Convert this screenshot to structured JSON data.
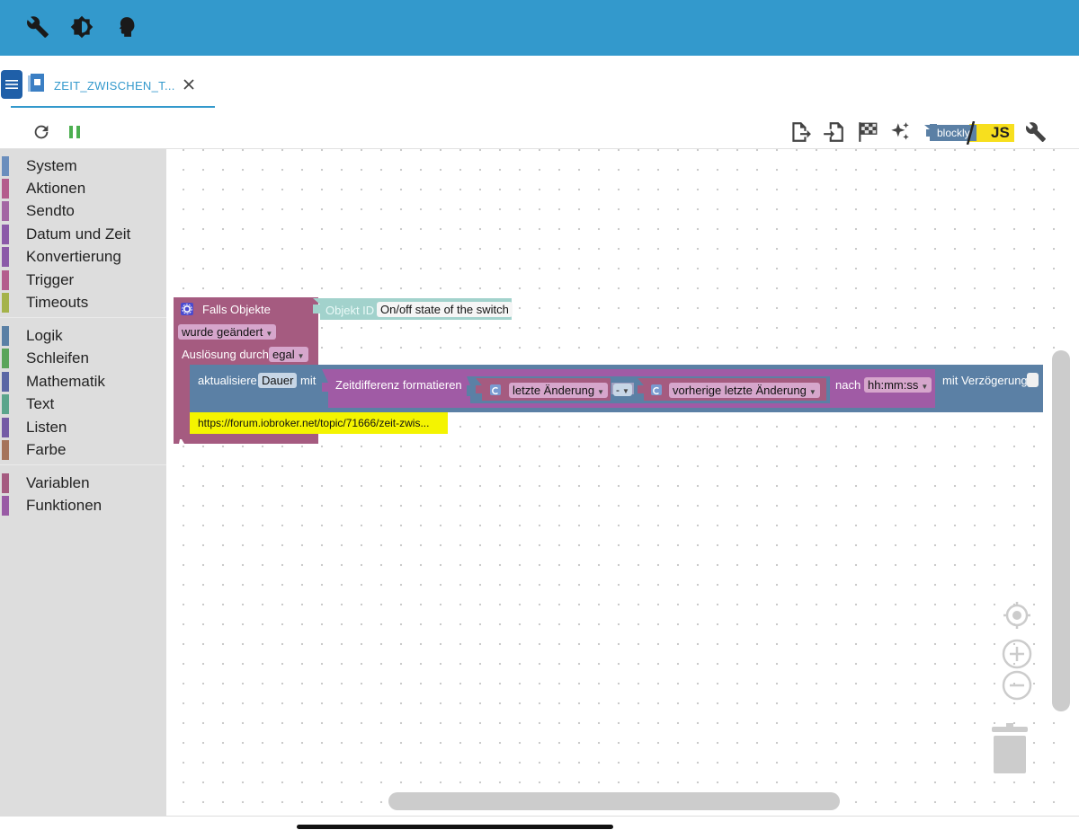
{
  "topbar": {
    "icons": [
      "wrench-icon",
      "settings-brightness-icon",
      "profile-icon"
    ]
  },
  "tab": {
    "label": "ZEIT_ZWISCHEN_T...",
    "close": "×"
  },
  "toolbar": {
    "left_icons": [
      "refresh-icon",
      "pause-icon"
    ],
    "right_icons": [
      "export-icon",
      "import-icon",
      "checkered-flag-icon",
      "magic-stars-icon",
      "blockly-js-toggle",
      "wrench-icon"
    ],
    "blockly_label": "blockly",
    "js_label": "JS"
  },
  "toolbox": {
    "groups": [
      [
        {
          "label": "System",
          "color": "#6a8ebd"
        },
        {
          "label": "Aktionen",
          "color": "#b45d8d"
        },
        {
          "label": "Sendto",
          "color": "#a366a3"
        },
        {
          "label": "Datum und Zeit",
          "color": "#8b5aa8"
        },
        {
          "label": "Konvertierung",
          "color": "#8b5aa8"
        },
        {
          "label": "Trigger",
          "color": "#b45d8d"
        },
        {
          "label": "Timeouts",
          "color": "#a5b34a"
        }
      ],
      [
        {
          "label": "Logik",
          "color": "#5a80a5"
        },
        {
          "label": "Schleifen",
          "color": "#5ba55b"
        },
        {
          "label": "Mathematik",
          "color": "#5b67a5"
        },
        {
          "label": "Text",
          "color": "#5ba58c"
        },
        {
          "label": "Listen",
          "color": "#745ba5"
        },
        {
          "label": "Farbe",
          "color": "#a5745b"
        }
      ],
      [
        {
          "label": "Variablen",
          "color": "#a55b80"
        },
        {
          "label": "Funktionen",
          "color": "#995ba5"
        }
      ]
    ]
  },
  "blocks": {
    "trigger": {
      "title": "Falls Objekte",
      "condition": "wurde geändert",
      "trigger_label": "Auslösung durch",
      "trigger_value": "egal",
      "color": "#a55b80"
    },
    "object": {
      "label": "Objekt ID",
      "value": "On/off state of the switch"
    },
    "update": {
      "label": "aktualisiere",
      "variable": "Dauer",
      "with": "mit",
      "delay_label": "mit Verzögerung",
      "color": "#5b80a5"
    },
    "format": {
      "label": "Zeitdifferenz formatieren",
      "after": "nach",
      "pattern": "hh:mm:ss",
      "color": "#a05ba5"
    },
    "last_change": {
      "value": "letzte Änderung"
    },
    "operator": {
      "value": "-"
    },
    "prev_change": {
      "value": "vorherige letzte Änderung"
    },
    "comment": {
      "value": "https://forum.iobroker.net/topic/71666/zeit-zwis..."
    }
  }
}
